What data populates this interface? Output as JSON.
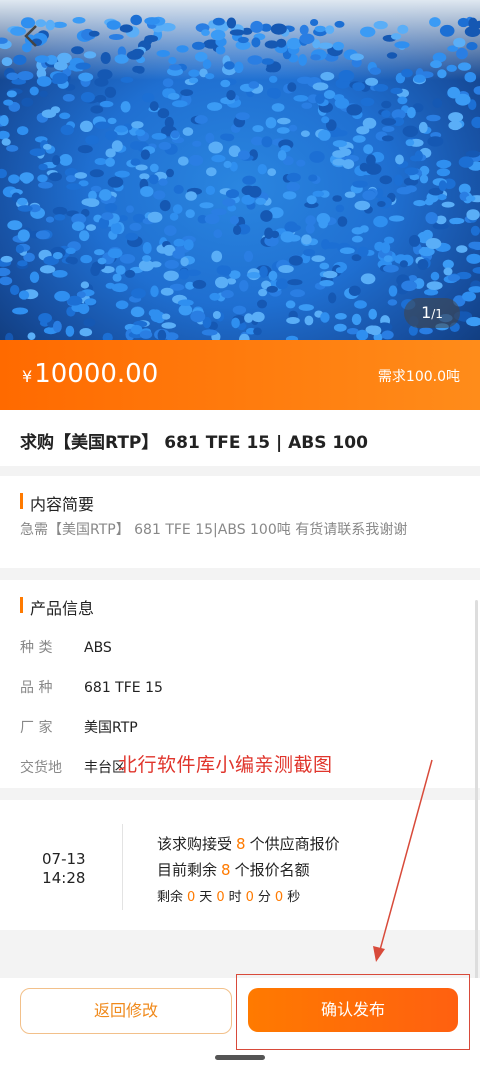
{
  "gallery": {
    "current": "1",
    "total": "/1"
  },
  "price": {
    "currency": "¥",
    "amount": "10000.00",
    "quantity": "需求100.0吨"
  },
  "title": "求购【美国RTP】 681 TFE 15 | ABS 100",
  "summary": {
    "heading": "内容简要",
    "text": "急需【美国RTP】 681 TFE 15|ABS  100吨   有货请联系我谢谢"
  },
  "product": {
    "heading": "产品信息",
    "rows": [
      {
        "k": "种   类",
        "v": "ABS"
      },
      {
        "k": "品   种",
        "v": "681 TFE 15"
      },
      {
        "k": "厂   家",
        "v": "美国RTP"
      },
      {
        "k": "交货地",
        "v": "丰台区"
      }
    ]
  },
  "watermark": "北行软件库小编亲测截图",
  "timing": {
    "date": "07-13",
    "time": "14:28",
    "l1a": "该求购接受",
    "l1n": "8",
    "l1b": "个供应商报价",
    "l2a": "目前剩余",
    "l2n": "8",
    "l2b": "个报价名额",
    "rem": "剩余",
    "d": "0",
    "du": "天",
    "h": "0",
    "hu": "时",
    "m": "0",
    "mu": "分",
    "s": "0",
    "su": "秒"
  },
  "actions": {
    "edit": "返回修改",
    "confirm": "确认发布"
  },
  "colors": {
    "accent": "#ff7a00",
    "annotation": "#d84a3a"
  }
}
